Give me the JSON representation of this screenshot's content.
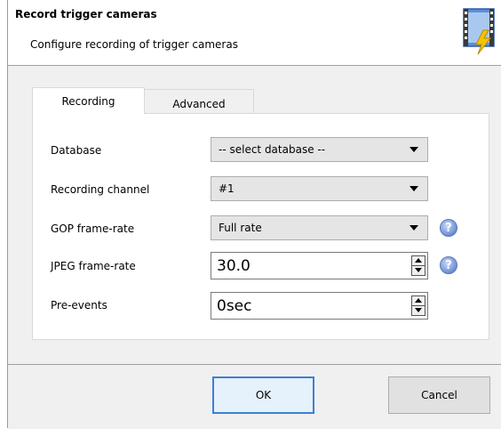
{
  "header": {
    "title": "Record trigger cameras",
    "subtitle": "Configure recording of trigger cameras",
    "icon": "film-lightning-icon"
  },
  "tabs": [
    {
      "label": "Recording",
      "active": true
    },
    {
      "label": "Advanced",
      "active": false
    }
  ],
  "fields": {
    "database": {
      "label": "Database",
      "value": "-- select database --"
    },
    "recording_channel": {
      "label": "Recording channel",
      "value": "#1"
    },
    "gop_frame_rate": {
      "label": "GOP frame-rate",
      "value": "Full rate",
      "help": "?"
    },
    "jpeg_frame_rate": {
      "label": "JPEG frame-rate",
      "value": "30.0",
      "help": "?"
    },
    "pre_events": {
      "label": "Pre-events",
      "value": "0sec"
    }
  },
  "buttons": {
    "ok": "OK",
    "cancel": "Cancel"
  },
  "colors": {
    "accent": "#3c7fd4",
    "help_icon": "#7f9fde"
  }
}
